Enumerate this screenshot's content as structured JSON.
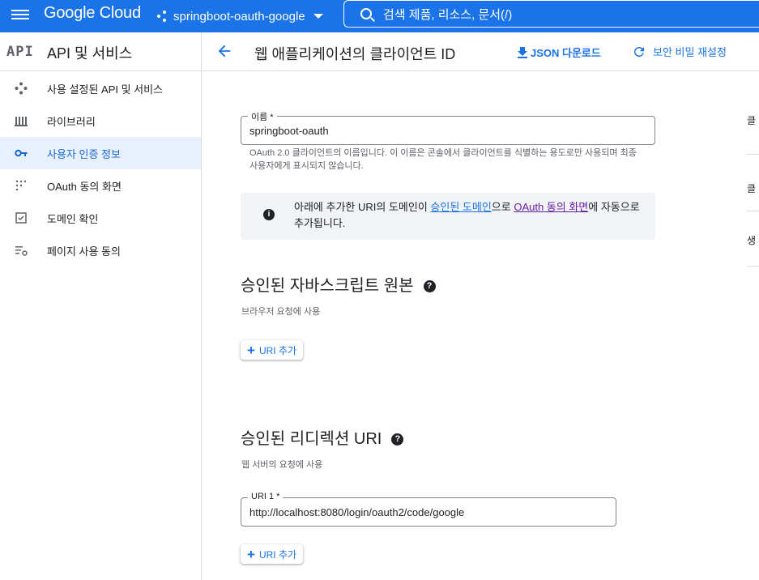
{
  "topbar": {
    "brand": "Google Cloud",
    "project": "springboot-oauth-google",
    "search_placeholder": "검색  제품, 리소스, 문서(/)"
  },
  "subheader": {
    "api_logo": "API",
    "api_title": "API 및 서비스",
    "page_title": "웹 애플리케이션의 클라이언트 ID",
    "json_download": "JSON 다운로드",
    "reset_secret": "보안 비밀 재설정"
  },
  "sidebar": {
    "items": [
      {
        "label": "사용 설정된 API 및 서비스",
        "icon": "diamond-dots-icon"
      },
      {
        "label": "라이브러리",
        "icon": "library-icon"
      },
      {
        "label": "사용자 인증 정보",
        "icon": "key-icon",
        "active": true
      },
      {
        "label": "OAuth 동의 화면",
        "icon": "dots-grid-icon"
      },
      {
        "label": "도메인 확인",
        "icon": "checkbox-icon"
      },
      {
        "label": "페이지 사용 동의",
        "icon": "settings-list-icon"
      }
    ]
  },
  "form": {
    "name_label": "이름 *",
    "name_value": "springboot-oauth",
    "name_helper": "OAuth 2.0 클라이언트의 이름입니다. 이 이름은 콘솔에서 클라이언트를 식별하는 용도로만 사용되며 최종 사용자에게 표시되지 않습니다.",
    "info_pre": "아래에 추가한 URI의 도메인이 ",
    "info_link1": "승인된 도메인",
    "info_mid": "으로 ",
    "info_link2": "OAuth 동의 화면",
    "info_post": "에 자동으로 추가됩니다."
  },
  "js_origins": {
    "title": "승인된 자바스크립트 원본",
    "desc": "브라우저 요청에 사용",
    "add_label": "URI 추가"
  },
  "redirect": {
    "title": "승인된 리디렉션 URI",
    "desc": "웹 서버의 요청에 사용",
    "uri1_label": "URI 1 *",
    "uri1_value": "http://localhost:8080/login/oauth2/code/google",
    "add_label": "URI 추가"
  },
  "right_peek": [
    "클",
    "클",
    "생"
  ],
  "colors": {
    "brand": "#1a73e8",
    "active_bg": "#e8f0fe",
    "visited_link": "#681da8"
  }
}
